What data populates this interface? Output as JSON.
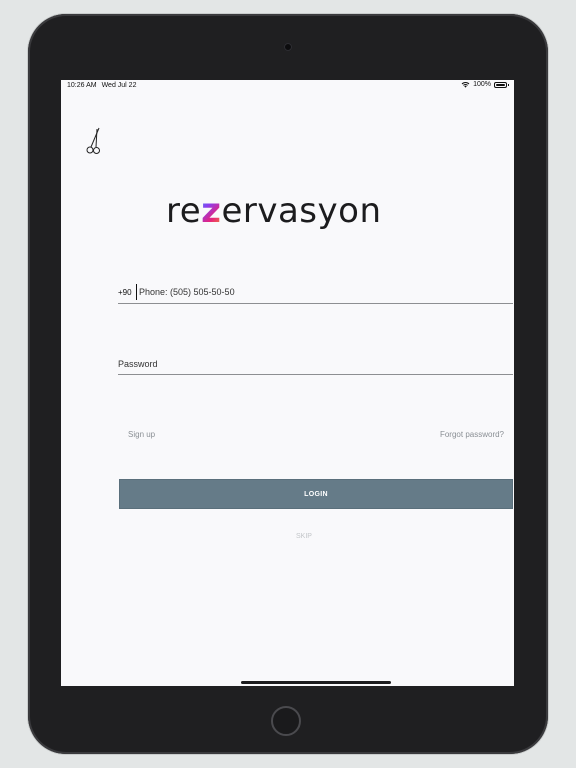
{
  "status_bar": {
    "time": "10:26 AM",
    "date": "Wed Jul 22",
    "battery": "100%",
    "battery_level": 1.0,
    "icons": [
      "wifi-icon",
      "battery-icon"
    ]
  },
  "header": {
    "icon": "scissors-icon"
  },
  "logo": {
    "prefix": "re",
    "highlight": "z",
    "suffix": "ervasyon",
    "highlight_gradient": [
      "#2ba7e6",
      "#8a3ff0",
      "#e6237d",
      "#f7a21b"
    ]
  },
  "form": {
    "phone": {
      "country_code": "+90",
      "value": "",
      "placeholder": "Phone: (505) 505-50-50"
    },
    "password": {
      "value": "",
      "placeholder": "Password"
    }
  },
  "links": {
    "sign_up": "Sign up",
    "forgot_password": "Forgot password?"
  },
  "buttons": {
    "login": "LOGIN",
    "skip": "SKIP"
  },
  "colors": {
    "primary_button": "#657b88",
    "link_text": "#8a8f94",
    "skip_text": "#c3c6c9",
    "background": "#f9f9fb"
  }
}
